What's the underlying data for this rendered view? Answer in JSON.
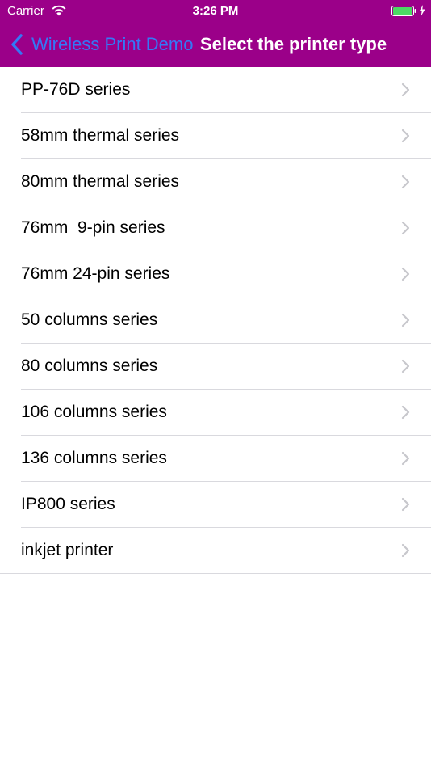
{
  "status_bar": {
    "carrier": "Carrier",
    "time": "3:26 PM",
    "battery_color": "#4cd964"
  },
  "nav": {
    "back_label": "Wireless Print Demo",
    "title": "Select the printer type",
    "bar_color": "#9b0089",
    "back_color": "#3478f6"
  },
  "printer_types": [
    {
      "label": "PP-76D series"
    },
    {
      "label": "58mm thermal series"
    },
    {
      "label": "80mm thermal series"
    },
    {
      "label": "76mm  9-pin series"
    },
    {
      "label": "76mm 24-pin series"
    },
    {
      "label": "50 columns series"
    },
    {
      "label": "80 columns series"
    },
    {
      "label": "106 columns series"
    },
    {
      "label": "136 columns series"
    },
    {
      "label": "IP800 series"
    },
    {
      "label": "inkjet printer"
    }
  ]
}
